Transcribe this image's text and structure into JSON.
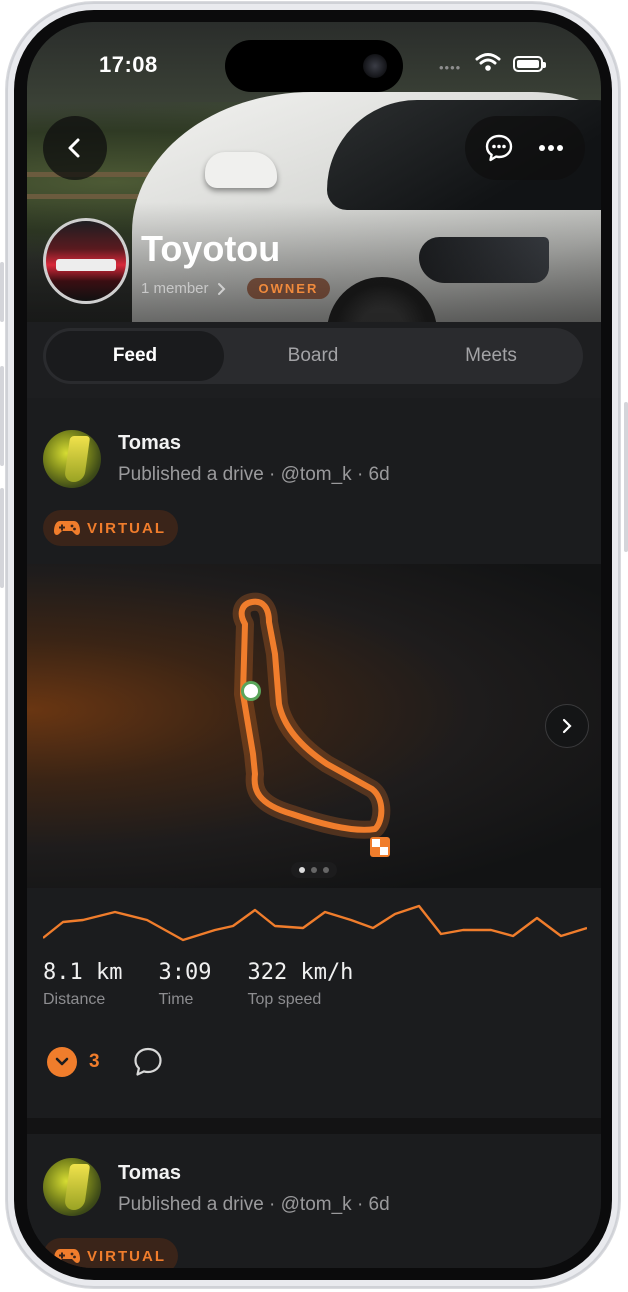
{
  "status_bar": {
    "time": "17:08"
  },
  "group": {
    "name": "Toyotou",
    "members": "1 member",
    "role_badge": "OWNER"
  },
  "tabs": [
    {
      "label": "Feed",
      "active": true
    },
    {
      "label": "Board",
      "active": false
    },
    {
      "label": "Meets",
      "active": false
    }
  ],
  "posts": [
    {
      "author": "Tomas",
      "subtitle": "Published a drive · @tom_k · 6d",
      "tag": "VIRTUAL",
      "carousel": {
        "pages": 3,
        "current": 1
      },
      "stats": [
        {
          "value": "8.1 km",
          "label": "Distance"
        },
        {
          "value": "3:09",
          "label": "Time"
        },
        {
          "value": "322 km/h",
          "label": "Top speed"
        }
      ],
      "kudos_count": "3"
    },
    {
      "author": "Tomas",
      "subtitle": "Published a drive · @tom_k · 6d",
      "tag": "VIRTUAL"
    }
  ],
  "colors": {
    "accent": "#f07d2c",
    "background": "#1b1c1e",
    "text": "#f2f2f2",
    "muted": "#9a9a9c"
  },
  "icons": {
    "back": "chevron-left-icon",
    "chat": "chat-bubble-icon",
    "more": "more-horizontal-icon",
    "virtual": "gamepad-icon",
    "kudos": "chevron-down-icon",
    "comment": "comment-icon",
    "next": "chevron-right-icon"
  }
}
